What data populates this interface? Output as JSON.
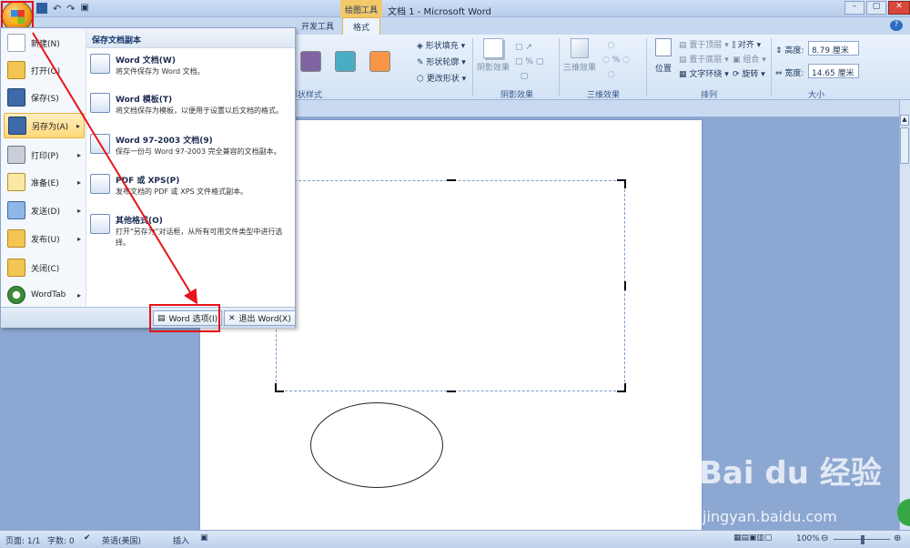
{
  "title_bar": {
    "contextual_tab_group": "绘图工具",
    "window_title": "文档 1 - Microsoft Word"
  },
  "ribbon_tabs": [
    "开发工具",
    "格式"
  ],
  "ribbon": {
    "shape_styles": {
      "label": "形状样式",
      "fill": "形状填充",
      "outline": "形状轮廓",
      "change": "更改形状",
      "swatches": [
        "#8064a2",
        "#4bacc6",
        "#f79646"
      ]
    },
    "shadow": {
      "label": "阴影效果",
      "button": "阴影效果"
    },
    "threed": {
      "label": "三维效果",
      "button": "三维效果"
    },
    "arrange": {
      "label": "排列",
      "position": "位置",
      "bring_front": "置于顶层",
      "send_back": "置于底层",
      "wrap": "文字环绕",
      "align": "对齐",
      "group": "组合",
      "rotate": "旋转"
    },
    "size": {
      "label": "大小",
      "height_label": "高度:",
      "height_value": "8.79 厘米",
      "width_label": "宽度:",
      "width_value": "14.65 厘米"
    }
  },
  "office_menu": {
    "items": [
      {
        "label": "新建(N)"
      },
      {
        "label": "打开(O)"
      },
      {
        "label": "保存(S)"
      },
      {
        "label": "另存为(A)"
      },
      {
        "label": "打印(P)"
      },
      {
        "label": "准备(E)"
      },
      {
        "label": "发送(D)"
      },
      {
        "label": "发布(U)"
      },
      {
        "label": "关闭(C)"
      },
      {
        "label": "WordTab"
      }
    ],
    "submenu_title": "保存文档副本",
    "submenu_items": [
      {
        "title": "Word 文档(W)",
        "desc": "将文件保存为 Word 文档。"
      },
      {
        "title": "Word 模板(T)",
        "desc": "将文档保存为模板，以便用于设置以后文档的格式。"
      },
      {
        "title": "Word 97-2003 文档(9)",
        "desc": "保存一份与 Word 97-2003 完全兼容的文档副本。"
      },
      {
        "title": "PDF 或 XPS(P)",
        "desc": "发布文档的 PDF 或 XPS 文件格式副本。"
      },
      {
        "title": "其他格式(O)",
        "desc": "打开\"另存为\"对话框，从所有可用文件类型中进行选择。"
      }
    ],
    "word_options": "Word 选项(I)",
    "exit_word": "退出 Word(X)"
  },
  "status_bar": {
    "page": "页面: 1/1",
    "words": "字数: 0",
    "language": "英语(美国)",
    "insert": "插入",
    "zoom": "100%"
  },
  "watermark": {
    "brand": "Bai du 经验",
    "url": "jingyan.baidu.com"
  },
  "colors": {
    "annotation_red": "#e8121a",
    "accent": "#f29a16"
  }
}
